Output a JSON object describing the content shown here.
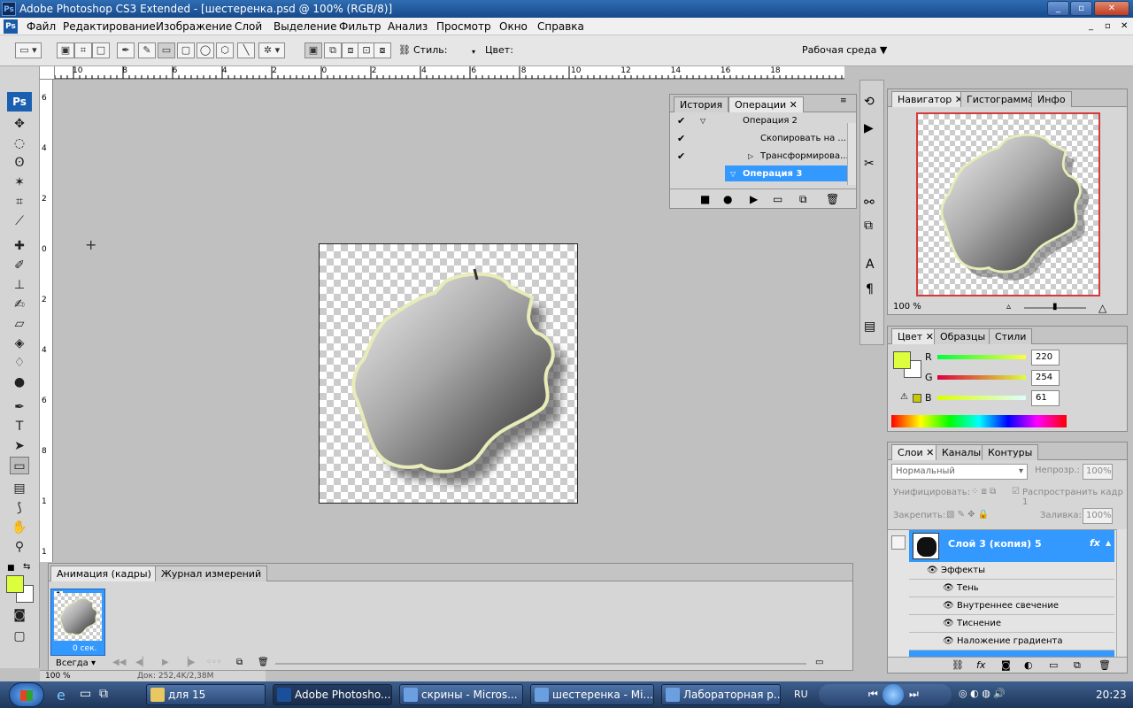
{
  "window": {
    "title": "Adobe Photoshop CS3 Extended - [шестеренка.psd @ 100% (RGB/8)]",
    "app_icon": "Ps"
  },
  "menu": [
    "Файл",
    "Редактирование",
    "Изображение",
    "Слой",
    "Выделение",
    "Фильтр",
    "Анализ",
    "Просмотр",
    "Окно",
    "Справка"
  ],
  "options": {
    "style_label": "Стиль:",
    "color_label": "Цвет:",
    "color_value": "#e0f820",
    "workspace_label": "Рабочая среда"
  },
  "ruler_top": [
    "10",
    "8",
    "6",
    "4",
    "2",
    "0",
    "2",
    "4",
    "6",
    "8",
    "10",
    "12",
    "14",
    "16",
    "18"
  ],
  "ruler_left": [
    "6",
    "4",
    "2",
    "0",
    "2",
    "4",
    "6",
    "8",
    "1",
    "1"
  ],
  "toolbox": {
    "ps_label": "Ps",
    "fg_color": "#dcfe3d",
    "bg_color": "#ffffff"
  },
  "actions_panel": {
    "tabs": [
      "История",
      "Операции"
    ],
    "rows": [
      {
        "label": "Операция 2",
        "checked": true
      },
      {
        "label": "Скопировать на ...",
        "checked": true
      },
      {
        "label": "Трансформирова...",
        "checked": true
      },
      {
        "label": "Операция 3",
        "checked": false,
        "selected": true
      }
    ]
  },
  "navigator_panel": {
    "tabs": [
      "Навигатор",
      "Гистограмма",
      "Инфо"
    ],
    "zoom": "100 %"
  },
  "color_panel": {
    "tabs": [
      "Цвет",
      "Образцы",
      "Стили"
    ],
    "r_label": "R",
    "r_value": "220",
    "g_label": "G",
    "g_value": "254",
    "b_label": "B",
    "b_value": "61",
    "swatch": "#dcfe3d"
  },
  "layers_panel": {
    "tabs": [
      "Слои",
      "Каналы",
      "Контуры"
    ],
    "blend_mode": "Нормальный",
    "opacity_label": "Непрозр.:",
    "opacity_value": "100%",
    "unify_label": "Унифицировать:",
    "propagate_label": "Распространить кадр 1",
    "lock_label": "Закрепить:",
    "fill_label": "Заливка:",
    "fill_value": "100%",
    "layer_name": "Слой 3 (копия) 5",
    "effects_label": "Эффекты",
    "effects": [
      "Тень",
      "Внутреннее свечение",
      "Тиснение",
      "Наложение градиента"
    ]
  },
  "animation_panel": {
    "tabs": [
      "Анимация (кадры)",
      "Журнал измерений"
    ],
    "frame_number": "1",
    "frame_delay": "0 сек.",
    "loop": "Всегда"
  },
  "status": {
    "zoom": "100 %",
    "doc": "Док: 252,4K/2,38M"
  },
  "taskbar": {
    "items": [
      "для 15",
      "Adobe Photosho...",
      "скрины - Micros...",
      "шестеренка - Mi...",
      "Лабораторная р..."
    ],
    "lang": "RU",
    "clock": "20:23"
  }
}
